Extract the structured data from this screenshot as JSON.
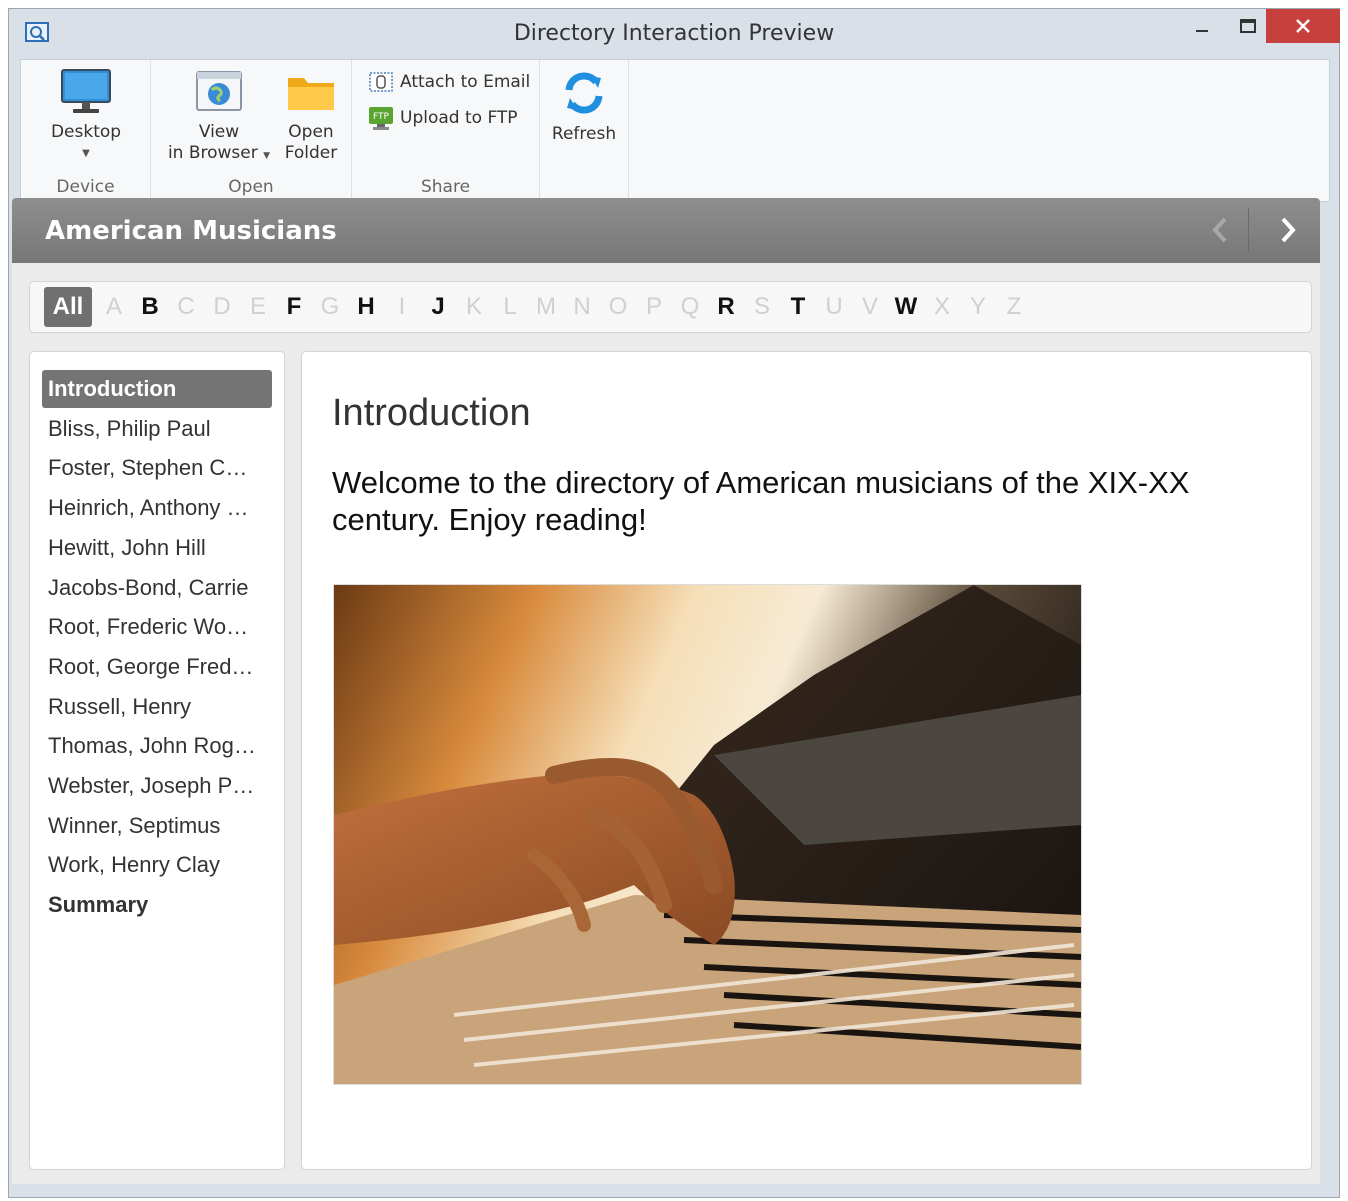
{
  "window": {
    "title": "Directory Interaction Preview"
  },
  "ribbon": {
    "device": {
      "button_label": "Desktop",
      "group_label": "Device"
    },
    "open": {
      "view_line1": "View",
      "view_line2": "in Browser",
      "folder_line1": "Open",
      "folder_line2": "Folder",
      "group_label": "Open"
    },
    "share": {
      "email_label": "Attach to Email",
      "ftp_label": "Upload to FTP",
      "group_label": "Share"
    },
    "refresh": {
      "label": "Refresh"
    }
  },
  "header": {
    "title": "American Musicians"
  },
  "alphabet": {
    "all_label": "All",
    "letters": [
      {
        "char": "A",
        "active": false
      },
      {
        "char": "B",
        "active": true
      },
      {
        "char": "C",
        "active": false
      },
      {
        "char": "D",
        "active": false
      },
      {
        "char": "E",
        "active": false
      },
      {
        "char": "F",
        "active": true
      },
      {
        "char": "G",
        "active": false
      },
      {
        "char": "H",
        "active": true
      },
      {
        "char": "I",
        "active": false
      },
      {
        "char": "J",
        "active": true
      },
      {
        "char": "K",
        "active": false
      },
      {
        "char": "L",
        "active": false
      },
      {
        "char": "M",
        "active": false
      },
      {
        "char": "N",
        "active": false
      },
      {
        "char": "O",
        "active": false
      },
      {
        "char": "P",
        "active": false
      },
      {
        "char": "Q",
        "active": false
      },
      {
        "char": "R",
        "active": true
      },
      {
        "char": "S",
        "active": false
      },
      {
        "char": "T",
        "active": true
      },
      {
        "char": "U",
        "active": false
      },
      {
        "char": "V",
        "active": false
      },
      {
        "char": "W",
        "active": true
      },
      {
        "char": "X",
        "active": false
      },
      {
        "char": "Y",
        "active": false
      },
      {
        "char": "Z",
        "active": false
      }
    ]
  },
  "sidebar": {
    "items": [
      "Introduction",
      "Bliss, Philip Paul",
      "Foster, Stephen C…",
      "Heinrich, Anthony …",
      "Hewitt, John Hill",
      "Jacobs-Bond, Carrie",
      "Root, Frederic Wo…",
      "Root, George Fred…",
      "Russell, Henry",
      "Thomas, John Rog…",
      "Webster, Joseph P…",
      "Winner, Septimus",
      "Work, Henry Clay",
      "Summary"
    ]
  },
  "main": {
    "title": "Introduction",
    "text": "Welcome to the directory of American musicians of the XIX-XX century. Enjoy reading!"
  },
  "colors": {
    "accent_gray": "#747474",
    "close_red": "#c8403e",
    "header_gray": "#828282"
  }
}
